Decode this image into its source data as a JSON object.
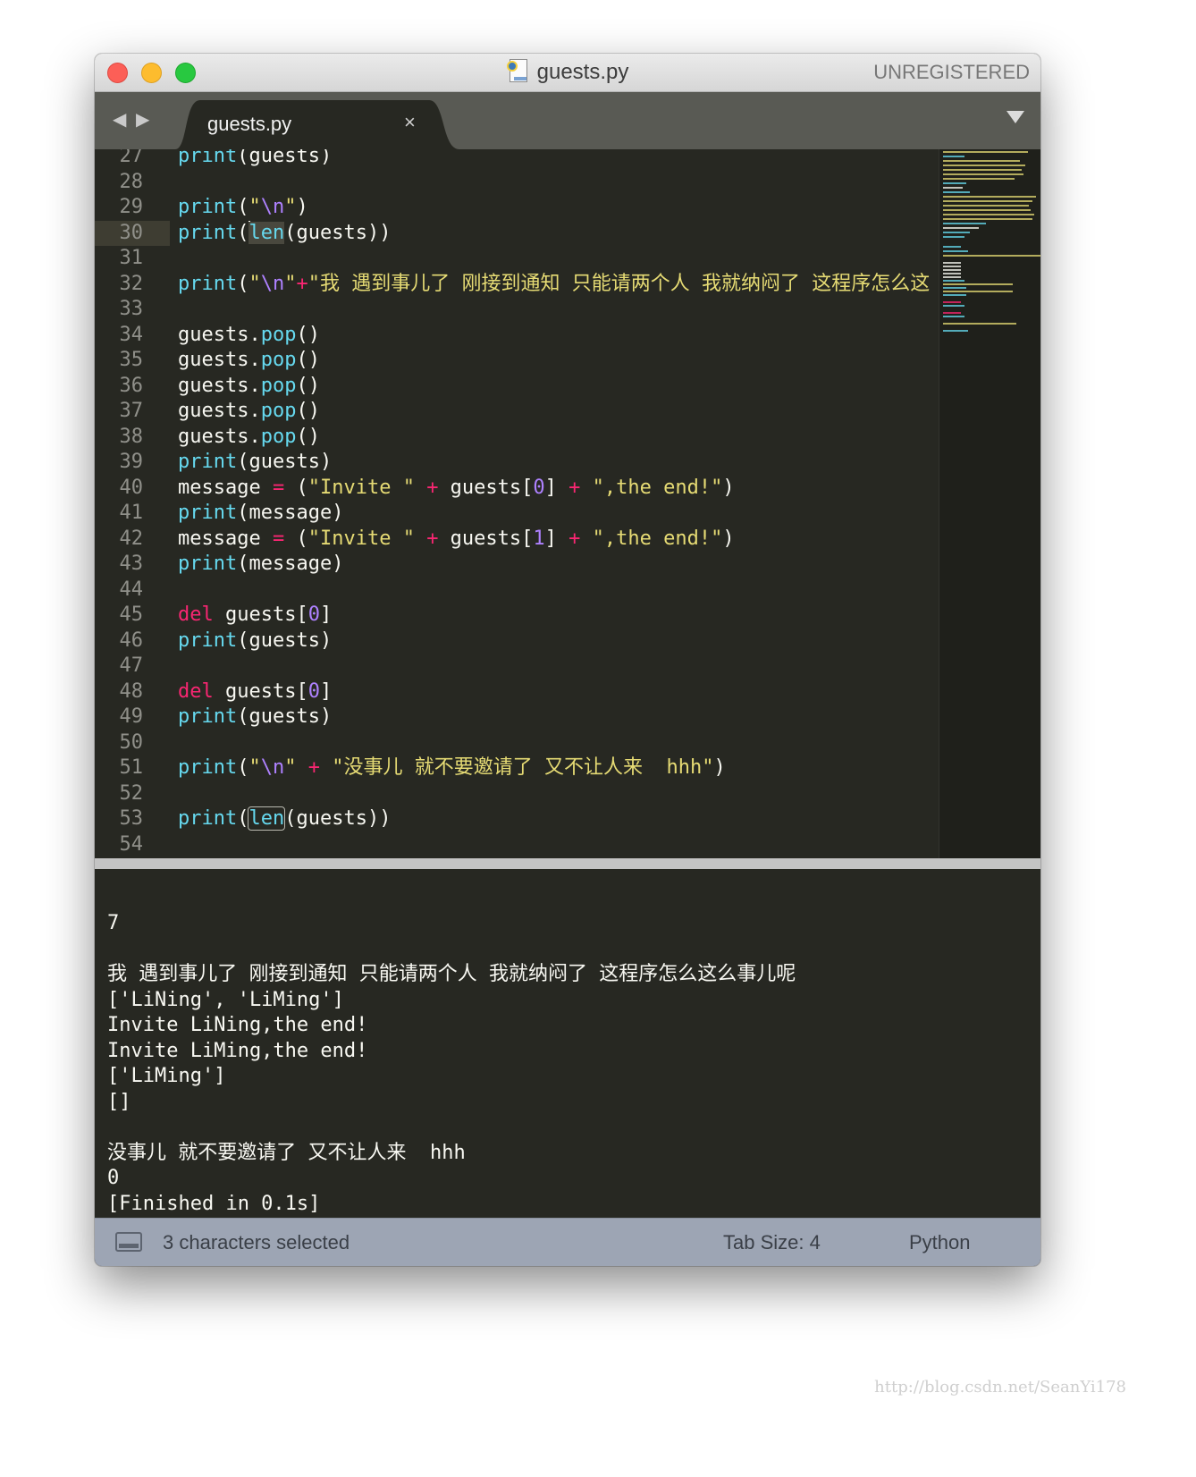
{
  "window": {
    "title": "guests.py",
    "registration": "UNREGISTERED"
  },
  "tabs": [
    {
      "label": "guests.py",
      "active": true,
      "close_glyph": "×"
    }
  ],
  "editor": {
    "lines": [
      {
        "num": "27"
      },
      {
        "num": "28"
      },
      {
        "num": "29"
      },
      {
        "num": "30",
        "current": true
      },
      {
        "num": "31"
      },
      {
        "num": "32",
        "text_cjk": "我 遇到事儿了 刚接到通知 只能请两个人 我就纳闷了 这程序怎么这"
      },
      {
        "num": "33"
      },
      {
        "num": "34"
      },
      {
        "num": "35"
      },
      {
        "num": "36"
      },
      {
        "num": "37"
      },
      {
        "num": "38"
      },
      {
        "num": "39"
      },
      {
        "num": "40",
        "text_a": "Invite ",
        "text_b": ",the end!"
      },
      {
        "num": "41"
      },
      {
        "num": "42",
        "text_a": "Invite ",
        "text_b": ",the end!"
      },
      {
        "num": "43"
      },
      {
        "num": "44"
      },
      {
        "num": "45"
      },
      {
        "num": "46"
      },
      {
        "num": "47"
      },
      {
        "num": "48"
      },
      {
        "num": "49"
      },
      {
        "num": "50"
      },
      {
        "num": "51",
        "text_cjk": "没事儿 就不要邀请了 又不让人来  hhh"
      },
      {
        "num": "52"
      },
      {
        "num": "53"
      },
      {
        "num": "54"
      }
    ]
  },
  "output": {
    "lines": [
      "",
      "",
      "7",
      "",
      "我 遇到事儿了 刚接到通知 只能请两个人 我就纳闷了 这程序怎么这么事儿呢",
      "['LiNing', 'LiMing']",
      "Invite LiNing,the end!",
      "Invite LiMing,the end!",
      "['LiMing']",
      "[]",
      "",
      "没事儿 就不要邀请了 又不让人来  hhh",
      "0",
      "[Finished in 0.1s]"
    ]
  },
  "status": {
    "panel_icon": "console-panel-icon",
    "selection": "3 characters selected",
    "tab_size": "Tab Size: 4",
    "syntax": "Python"
  },
  "watermark": "http://blog.csdn.net/SeanYi178",
  "colors": {
    "background": "#272822",
    "keyword": "#66d9ef",
    "operator": "#f92672",
    "string": "#e6db74",
    "number": "#ae81ff",
    "status_bar": "#9da5b4"
  }
}
